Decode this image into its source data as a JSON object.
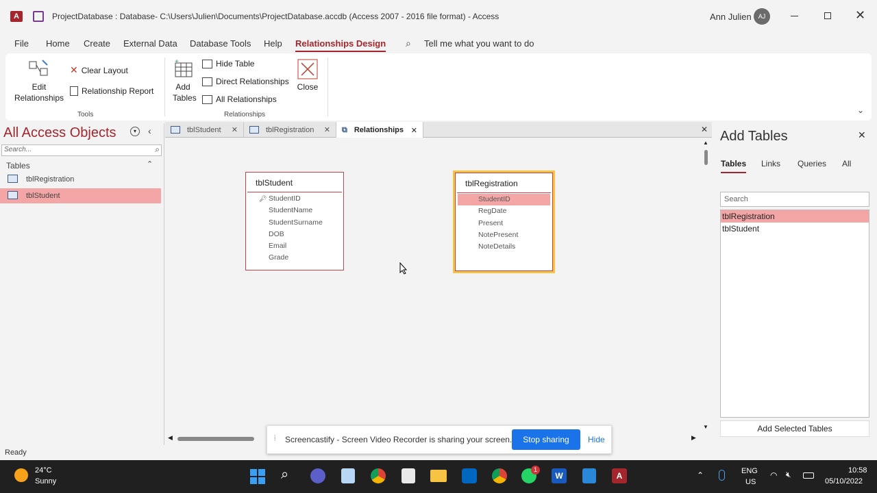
{
  "window": {
    "title": "ProjectDatabase : Database- C:\\Users\\Julien\\Documents\\ProjectDatabase.accdb (Access 2007 - 2016 file format)  -  Access",
    "user_name": "Ann Julien",
    "user_initials": "AJ"
  },
  "ribbon_tabs": [
    "File",
    "Home",
    "Create",
    "External Data",
    "Database Tools",
    "Help",
    "Relationships Design"
  ],
  "tell_me": "Tell me what you want to do",
  "ribbon": {
    "edit_relationships": "Edit Relationships",
    "clear_layout": "Clear Layout",
    "relationship_report": "Relationship Report",
    "tools_label": "Tools",
    "add_tables": "Add Tables",
    "hide_table": "Hide Table",
    "direct_relationships": "Direct Relationships",
    "all_relationships": "All Relationships",
    "relationships_label": "Relationships",
    "close": "Close"
  },
  "nav": {
    "title": "All Access Objects",
    "search_placeholder": "Search...",
    "section": "Tables",
    "items": [
      "tblRegistration",
      "tblStudent"
    ]
  },
  "doc_tabs": [
    "tblStudent",
    "tblRegistration",
    "Relationships"
  ],
  "tables": {
    "student": {
      "name": "tblStudent",
      "fields": [
        "StudentID",
        "StudentName",
        "StudentSurname",
        "DOB",
        "Email",
        "Grade"
      ]
    },
    "registration": {
      "name": "tblRegistration",
      "fields": [
        "StudentID",
        "RegDate",
        "Present",
        "NotePresent",
        "NoteDetails"
      ]
    }
  },
  "add_tables_pane": {
    "title": "Add Tables",
    "tabs": [
      "Tables",
      "Links",
      "Queries",
      "All"
    ],
    "search_placeholder": "Search",
    "items": [
      "tblRegistration",
      "tblStudent"
    ],
    "button": "Add Selected Tables"
  },
  "status": "Ready",
  "screencast": {
    "message": "Screencastify - Screen Video Recorder is sharing your screen.",
    "stop": "Stop sharing",
    "hide": "Hide"
  },
  "taskbar": {
    "temp": "24°C",
    "weather": "Sunny",
    "lang1": "ENG",
    "lang2": "US",
    "time": "10:58",
    "date": "05/10/2022",
    "whatsapp_badge": "1"
  },
  "colors": {
    "accent": "#a4262c",
    "selection": "#f4a6a6",
    "highlight": "#f6c343"
  }
}
